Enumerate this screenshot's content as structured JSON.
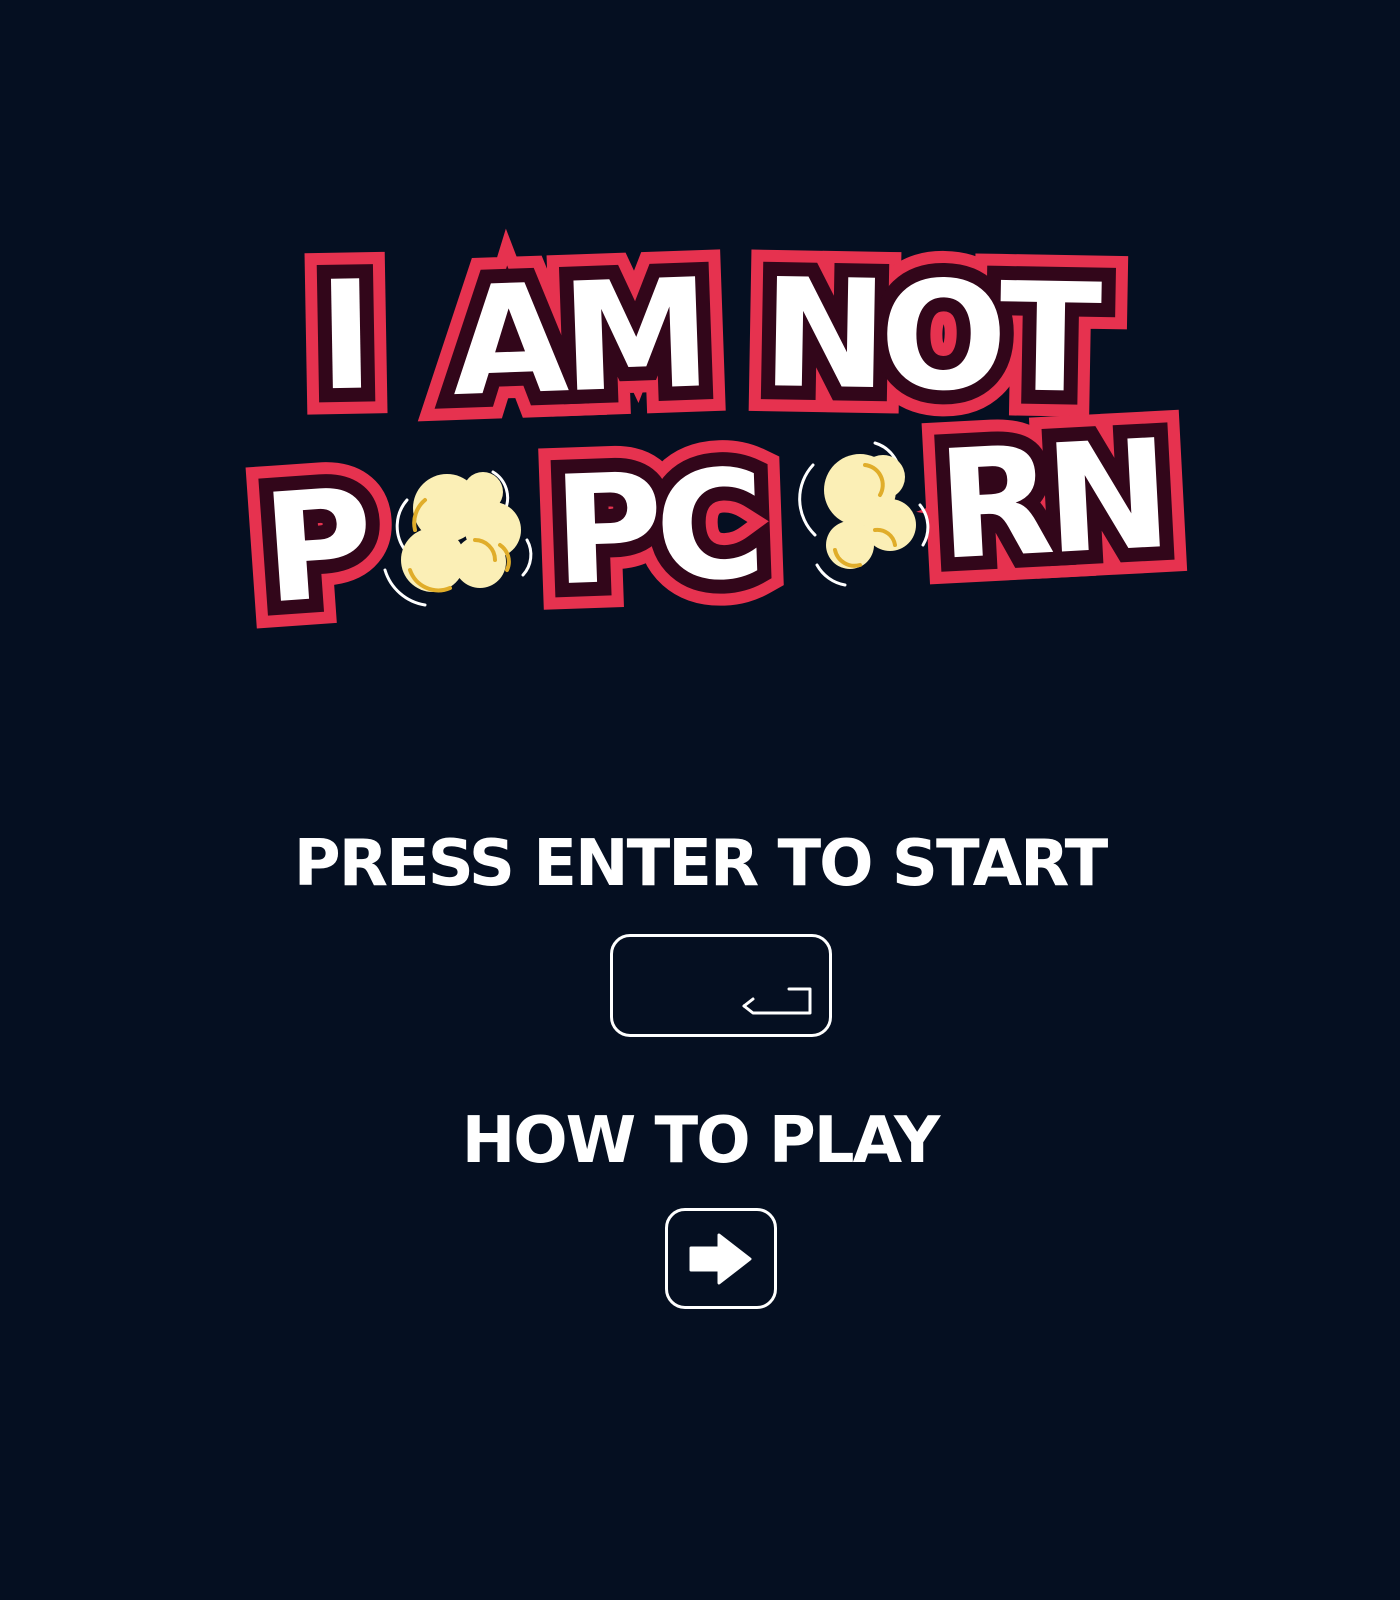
{
  "logo": {
    "line1_words": [
      "I",
      "AM",
      "NOT"
    ],
    "line2_segments": [
      "P",
      "PC",
      "RN"
    ],
    "logo_icons": [
      "popcorn-kernel-icon",
      "popcorn-kernel-icon"
    ],
    "colors": {
      "fill": "#ffffff",
      "inner_outline": "#32061a",
      "outer_outline": "#e6324f",
      "popcorn": "#fbefb6",
      "popcorn_shade": "#e0ad2a"
    }
  },
  "menu": {
    "start_label": "PRESS ENTER TO START",
    "enter_key_icon": "enter-key-icon",
    "howto_label": "HOW TO PLAY",
    "arrow_key_icon": "right-arrow-key-icon"
  },
  "colors": {
    "background": "#050f21",
    "text": "#ffffff"
  }
}
